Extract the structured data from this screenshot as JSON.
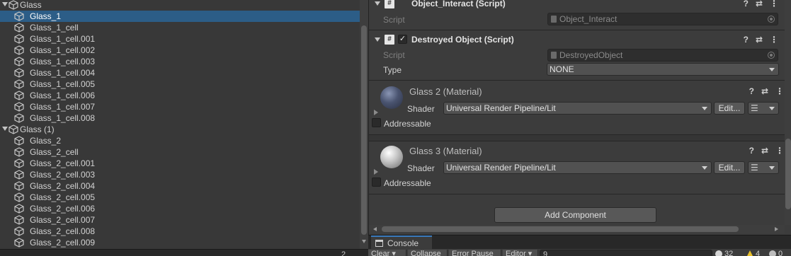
{
  "hierarchy": {
    "items": [
      {
        "label": "Glass",
        "indent": 0,
        "expanded": true,
        "selected": false
      },
      {
        "label": "Glass_1",
        "indent": 1,
        "expanded": false,
        "selected": true
      },
      {
        "label": "Glass_1_cell",
        "indent": 1,
        "expanded": false,
        "selected": false
      },
      {
        "label": "Glass_1_cell.001",
        "indent": 1,
        "expanded": false,
        "selected": false
      },
      {
        "label": "Glass_1_cell.002",
        "indent": 1,
        "expanded": false,
        "selected": false
      },
      {
        "label": "Glass_1_cell.003",
        "indent": 1,
        "expanded": false,
        "selected": false
      },
      {
        "label": "Glass_1_cell.004",
        "indent": 1,
        "expanded": false,
        "selected": false
      },
      {
        "label": "Glass_1_cell.005",
        "indent": 1,
        "expanded": false,
        "selected": false
      },
      {
        "label": "Glass_1_cell.006",
        "indent": 1,
        "expanded": false,
        "selected": false
      },
      {
        "label": "Glass_1_cell.007",
        "indent": 1,
        "expanded": false,
        "selected": false
      },
      {
        "label": "Glass_1_cell.008",
        "indent": 1,
        "expanded": false,
        "selected": false
      },
      {
        "label": "Glass (1)",
        "indent": 0,
        "expanded": true,
        "selected": false
      },
      {
        "label": "Glass_2",
        "indent": 1,
        "expanded": false,
        "selected": false
      },
      {
        "label": "Glass_2_cell",
        "indent": 1,
        "expanded": false,
        "selected": false
      },
      {
        "label": "Glass_2_cell.001",
        "indent": 1,
        "expanded": false,
        "selected": false
      },
      {
        "label": "Glass_2_cell.003",
        "indent": 1,
        "expanded": false,
        "selected": false
      },
      {
        "label": "Glass_2_cell.004",
        "indent": 1,
        "expanded": false,
        "selected": false
      },
      {
        "label": "Glass_2_cell.005",
        "indent": 1,
        "expanded": false,
        "selected": false
      },
      {
        "label": "Glass_2_cell.006",
        "indent": 1,
        "expanded": false,
        "selected": false
      },
      {
        "label": "Glass_2_cell.007",
        "indent": 1,
        "expanded": false,
        "selected": false
      },
      {
        "label": "Glass_2_cell.008",
        "indent": 1,
        "expanded": false,
        "selected": false
      },
      {
        "label": "Glass_2_cell.009",
        "indent": 1,
        "expanded": false,
        "selected": false
      }
    ],
    "footer_count": "2"
  },
  "inspector": {
    "object_interact": {
      "title": "Object_Interact (Script)",
      "script_label": "Script",
      "script_value": "Object_Interact"
    },
    "destroyed_object": {
      "title": "Destroyed Object (Script)",
      "enabled_check": "✓",
      "script_label": "Script",
      "script_value": "DestroyedObject",
      "type_label": "Type",
      "type_value": "NONE"
    },
    "material_1": {
      "title": "Glass 2 (Material)",
      "shader_label": "Shader",
      "shader_value": "Universal Render Pipeline/Lit",
      "edit_label": "Edit...",
      "addressable_label": "Addressable"
    },
    "material_2": {
      "title": "Glass 3 (Material)",
      "shader_label": "Shader",
      "shader_value": "Universal Render Pipeline/Lit",
      "edit_label": "Edit...",
      "addressable_label": "Addressable"
    },
    "add_component_label": "Add Component",
    "header_icons": {
      "help": "?",
      "presets": "⇄",
      "menu": "⋮"
    }
  },
  "console": {
    "tab_label": "Console",
    "toolbar": {
      "clear": "Clear",
      "collapse": "Collapse",
      "error_pause": "Error Pause",
      "editor": "Editor",
      "search_value": "9",
      "info_count": "32",
      "warning_count": "4",
      "error_count": "0"
    }
  },
  "colors": {
    "selection": "#2c5d87",
    "panel": "#383838",
    "inspector": "#3c3c3c",
    "accent": "#3a79bb",
    "warning": "#e8c02a"
  }
}
